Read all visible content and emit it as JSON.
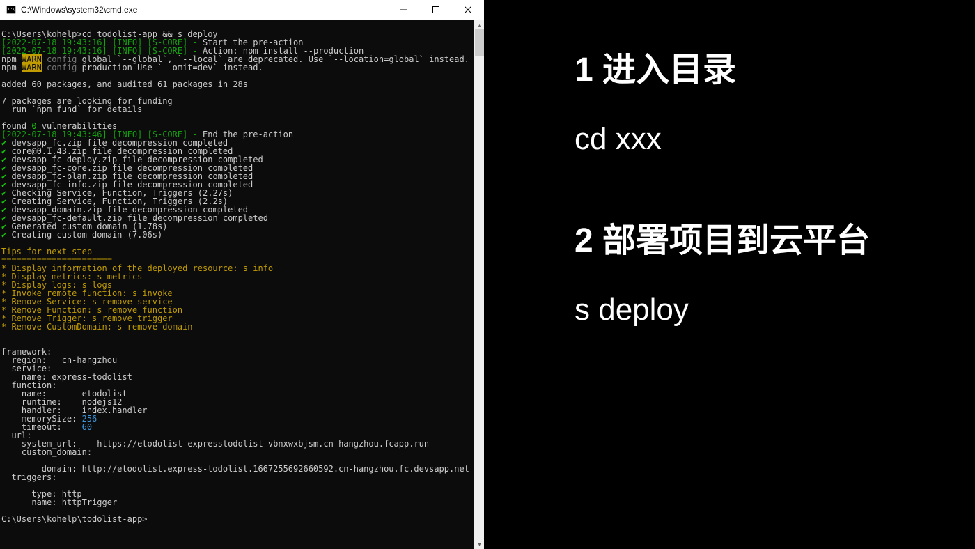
{
  "window": {
    "title": "C:\\Windows\\system32\\cmd.exe"
  },
  "prompt1": "C:\\Users\\kohelp>",
  "command1": "cd todolist-app && s deploy",
  "log_ts1": "[2022-07-18 19:43:16] [INFO] [S-CORE]",
  "log_sep": " - ",
  "log_msg1": "Start the pre-action",
  "log_msg2": "Action: npm install --production",
  "npm_label": "npm ",
  "warn_label": "WARN",
  "config_label": " config",
  "npm_warn1": " global `--global`, `--local` are deprecated. Use `--location=global` instead.",
  "npm_warn2": " production Use `--omit=dev` instead.",
  "added_line": "added 60 packages, and audited 61 packages in 28s",
  "funding_line1": "7 packages are looking for funding",
  "funding_line2": "  run `npm fund` for details",
  "found_prefix": "found ",
  "found_zero": "0",
  "found_suffix": " vulnerabilities",
  "log_ts2": "[2022-07-18 19:43:46] [INFO] [S-CORE]",
  "log_msg3": "End the pre-action",
  "check_symbol": "✔",
  "checks": [
    " devsapp_fc.zip file decompression completed",
    " core@0.1.43.zip file decompression completed",
    " devsapp_fc-deploy.zip file decompression completed",
    " devsapp_fc-core.zip file decompression completed",
    " devsapp_fc-plan.zip file decompression completed",
    " devsapp_fc-info.zip file decompression completed",
    " Checking Service, Function, Triggers (2.27s)",
    " Creating Service, Function, Triggers (2.2s)",
    " devsapp_domain.zip file decompression completed",
    " devsapp_fc-default.zip file decompression completed",
    " Generated custom domain (1.78s)",
    " Creating custom domain (7.06s)"
  ],
  "tips_header": "Tips for next step",
  "tips_sep": "======================",
  "tips": [
    "* Display information of the deployed resource: s info",
    "* Display metrics: s metrics",
    "* Display logs: s logs",
    "* Invoke remote function: s invoke",
    "* Remove Service: s remove service",
    "* Remove Function: s remove function",
    "* Remove Trigger: s remove trigger",
    "* Remove CustomDomain: s remove domain"
  ],
  "output": {
    "framework": "framework:",
    "region_k": "  region:   ",
    "region_v": "cn-hangzhou",
    "service": "  service:",
    "sname_k": "    name: ",
    "sname_v": "express-todolist",
    "function": "  function:",
    "fname_k": "    name:       ",
    "fname_v": "etodolist",
    "runtime_k": "    runtime:    ",
    "runtime_v": "nodejs12",
    "handler_k": "    handler:    ",
    "handler_v": "index.handler",
    "mem_k": "    memorySize: ",
    "mem_v": "256",
    "timeout_k": "    timeout:    ",
    "timeout_v": "60",
    "url": "  url:",
    "sysurl_k": "    system_url:    ",
    "sysurl_v": "https://etodolist-expresstodolist-vbnxwxbjsm.cn-hangzhou.fcapp.run",
    "cdomain": "    custom_domain:",
    "dash": "      -",
    "domain_k": "        domain: ",
    "domain_v": "http://etodolist.express-todolist.1667255692660592.cn-hangzhou.fc.devsapp.net",
    "triggers": "  triggers:",
    "tdash": "    -",
    "ttype_k": "      type: ",
    "ttype_v": "http",
    "tname_k": "      name: ",
    "tname_v": "httpTrigger"
  },
  "prompt2": "C:\\Users\\kohelp\\todolist-app>",
  "instructions": {
    "step1_title": "1 进入目录",
    "step1_cmd": "cd xxx",
    "step2_title": "2 部署项目到云平台",
    "step2_cmd": "s deploy"
  }
}
